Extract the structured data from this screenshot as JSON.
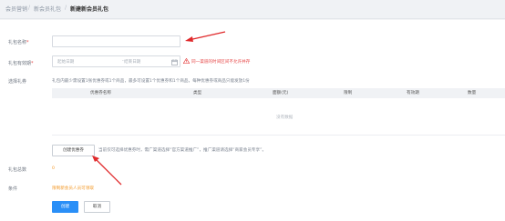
{
  "breadcrumb": {
    "items": [
      "会员营销",
      "新会员礼包",
      "新建新会员礼包"
    ]
  },
  "form": {
    "name": {
      "label": "礼包名称",
      "required_mark": "*",
      "value": ""
    },
    "valid_time": {
      "label": "礼包有效期",
      "required_mark": "*",
      "start_placeholder": "起始日期",
      "end_placeholder": "结束日期",
      "error": "同一渠道的时间区间不允许并存"
    },
    "gift": {
      "label": "选择礼券",
      "hint": "礼包内最少需设置1张优惠券或1个商品，最多可设置1个优惠券和1个商品，每种优惠券或商品只能发放1份"
    },
    "table": {
      "columns": [
        "优惠券名称",
        "类型",
        "面额(元)",
        "限制",
        "有效期",
        "数量"
      ],
      "empty_text": "没有数据"
    },
    "create_coupon": {
      "button": "创建优惠券",
      "note": "当前仅可选择优惠券时，需广渠道选择“官方渠道推广”，推广渠道请选择“商家会员专享”。"
    },
    "total": {
      "label": "礼包总数",
      "value": "0"
    },
    "condition": {
      "label": "条件",
      "value": "限制新会员人员可领取"
    }
  },
  "actions": {
    "submit": "创建",
    "cancel": "取消"
  },
  "colors": {
    "primary": "#2a8ff7",
    "error": "#e64545",
    "annotation": "#e0292b",
    "orange": "#f39a2a"
  }
}
